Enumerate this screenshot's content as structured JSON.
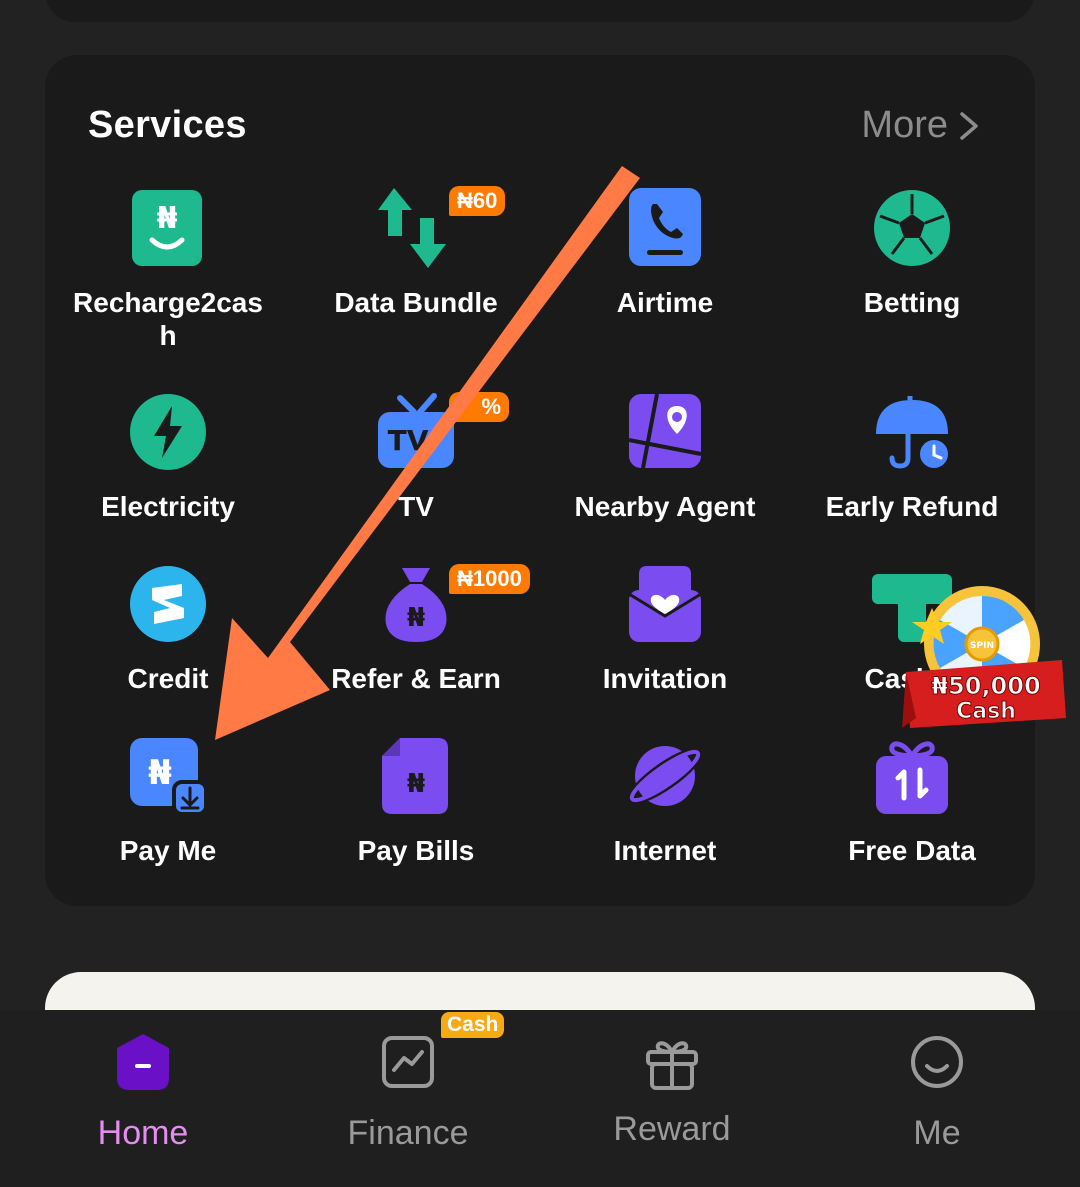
{
  "services": {
    "title": "Services",
    "more_label": "More",
    "items": [
      {
        "label": "Recharge2cash",
        "icon": "naira-smile-icon",
        "color": "#1fb98f"
      },
      {
        "label": "Data Bundle",
        "icon": "data-arrows-icon",
        "color": "#1fb98f",
        "badge": "₦60"
      },
      {
        "label": "Airtime",
        "icon": "phone-icon",
        "color": "#4a86ff"
      },
      {
        "label": "Betting",
        "icon": "soccer-ball-icon",
        "color": "#1fb98f"
      },
      {
        "label": "Electricity",
        "icon": "lightning-icon",
        "color": "#1fb98f"
      },
      {
        "label": "TV",
        "icon": "tv-icon",
        "color": "#4a86ff",
        "badge": "%"
      },
      {
        "label": "Nearby Agent",
        "icon": "map-pin-icon",
        "color": "#7b4cf0"
      },
      {
        "label": "Early Refund",
        "icon": "umbrella-clock-icon",
        "color": "#4a86ff"
      },
      {
        "label": "Credit",
        "icon": "credit-s-icon",
        "color": "#2cb5ec"
      },
      {
        "label": "Refer & Earn",
        "icon": "money-bag-icon",
        "color": "#7b4cf0",
        "badge": "₦1000"
      },
      {
        "label": "Invitation",
        "icon": "heart-envelope-icon",
        "color": "#7b4cf0"
      },
      {
        "label": "Cash S",
        "icon": "cash-t-icon",
        "color": "#1fb98f"
      },
      {
        "label": "Pay Me",
        "icon": "naira-receive-icon",
        "color": "#4a86ff"
      },
      {
        "label": "Pay Bills",
        "icon": "bill-icon",
        "color": "#7b4cf0"
      },
      {
        "label": "Internet",
        "icon": "planet-icon",
        "color": "#7b4cf0"
      },
      {
        "label": "Free Data",
        "icon": "gift-data-icon",
        "color": "#7b4cf0"
      }
    ]
  },
  "promo": {
    "amount": "₦50,000",
    "word": "Cash",
    "spin": "SPIN"
  },
  "nav": {
    "items": [
      {
        "label": "Home",
        "icon": "home-icon",
        "active": true
      },
      {
        "label": "Finance",
        "icon": "chart-icon",
        "active": false
      },
      {
        "label": "Reward",
        "icon": "gift-icon",
        "active": false
      },
      {
        "label": "Me",
        "icon": "smile-icon",
        "active": false
      }
    ],
    "finance_badge": "Cash"
  },
  "annotation": {
    "arrow_color": "#ff7a45"
  }
}
